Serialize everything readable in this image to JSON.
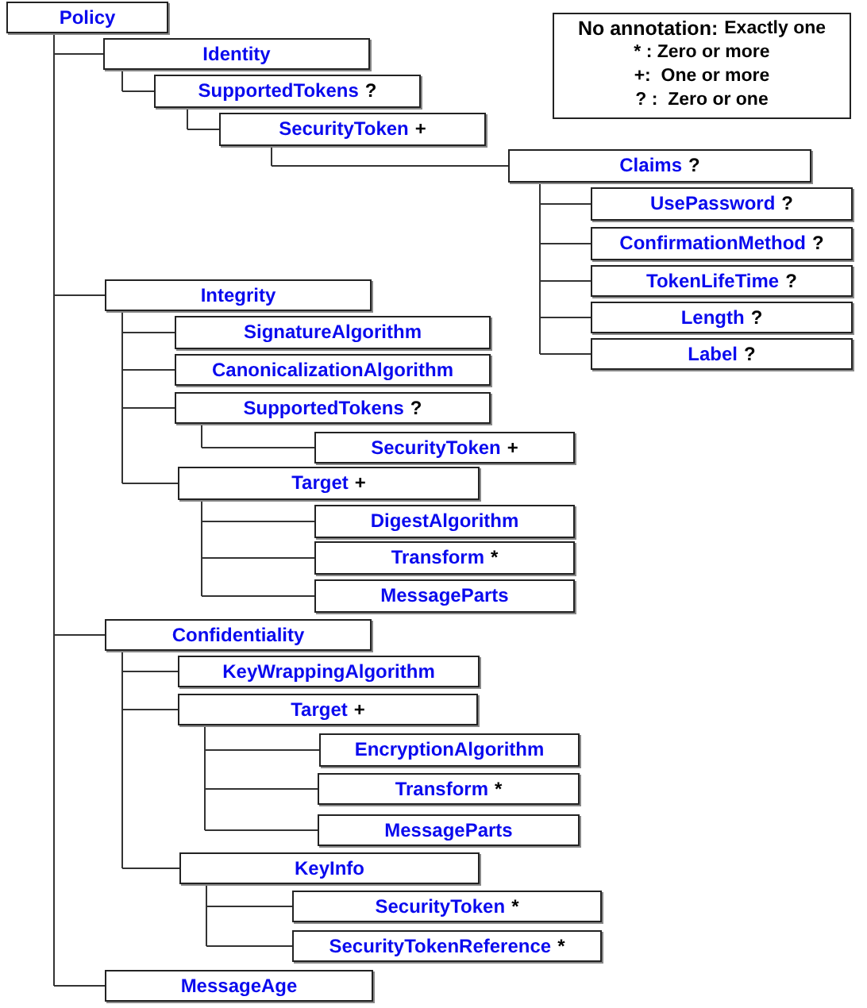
{
  "legend": {
    "title": "No annotation:",
    "title_note": "Exactly one",
    "entries": [
      "* : Zero or more",
      "+:  One or more",
      "? :  Zero or one"
    ]
  },
  "tree": {
    "name": "Policy",
    "children": [
      {
        "name": "Identity",
        "children": [
          {
            "name": "SupportedTokens",
            "cardinality": "?",
            "children": [
              {
                "name": "SecurityToken",
                "cardinality": "+",
                "children": [
                  {
                    "name": "Claims",
                    "cardinality": "?",
                    "children": [
                      {
                        "name": "UsePassword",
                        "cardinality": "?"
                      },
                      {
                        "name": "ConfirmationMethod",
                        "cardinality": "?"
                      },
                      {
                        "name": "TokenLifeTime",
                        "cardinality": "?"
                      },
                      {
                        "name": "Length",
                        "cardinality": "?"
                      },
                      {
                        "name": "Label",
                        "cardinality": "?"
                      }
                    ]
                  }
                ]
              }
            ]
          }
        ]
      },
      {
        "name": "Integrity",
        "children": [
          {
            "name": "SignatureAlgorithm"
          },
          {
            "name": "CanonicalizationAlgorithm"
          },
          {
            "name": "SupportedTokens",
            "cardinality": "?",
            "children": [
              {
                "name": "SecurityToken",
                "cardinality": "+"
              }
            ]
          },
          {
            "name": "Target",
            "cardinality": "+",
            "children": [
              {
                "name": "DigestAlgorithm"
              },
              {
                "name": "Transform",
                "cardinality": "*"
              },
              {
                "name": "MessageParts"
              }
            ]
          }
        ]
      },
      {
        "name": "Confidentiality",
        "children": [
          {
            "name": "KeyWrappingAlgorithm"
          },
          {
            "name": "Target",
            "cardinality": "+",
            "children": [
              {
                "name": "EncryptionAlgorithm"
              },
              {
                "name": "Transform",
                "cardinality": "*"
              },
              {
                "name": "MessageParts"
              }
            ]
          },
          {
            "name": "KeyInfo",
            "children": [
              {
                "name": "SecurityToken",
                "cardinality": "*"
              },
              {
                "name": "SecurityTokenReference",
                "cardinality": "*"
              }
            ]
          }
        ]
      },
      {
        "name": "MessageAge"
      }
    ]
  }
}
